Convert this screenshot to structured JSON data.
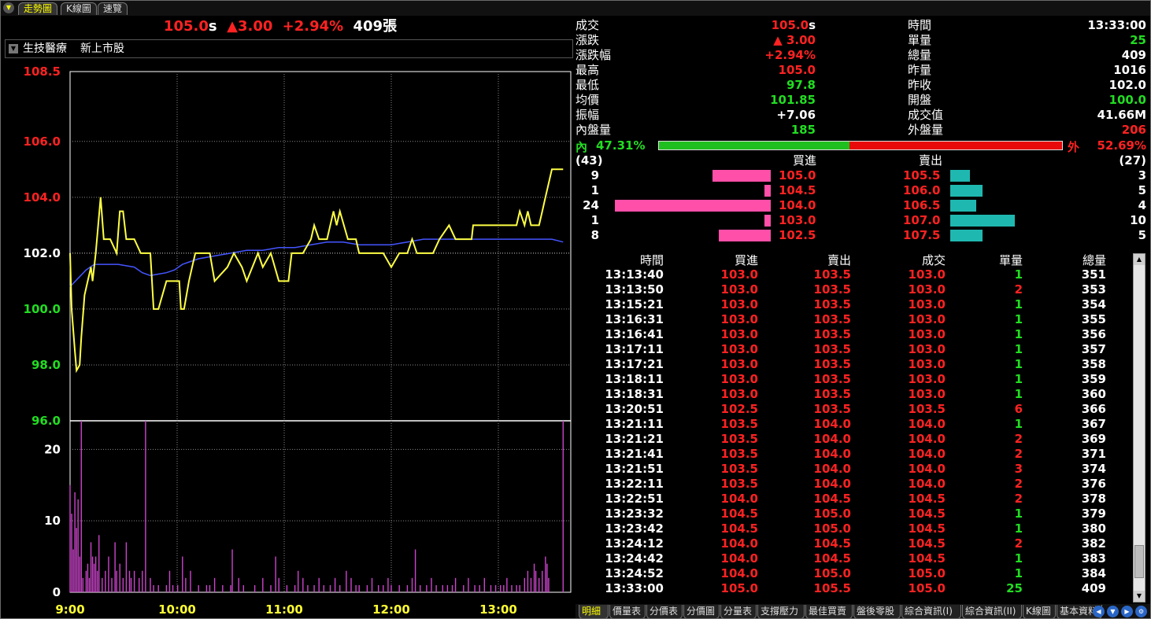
{
  "top_tabs": [
    "走勢圖",
    "K線圖",
    "速覽"
  ],
  "header": {
    "price": "105.0",
    "price_flag": "s",
    "change": "3.00",
    "change_pct": "+2.94%",
    "volume": "409",
    "volume_unit": "張"
  },
  "category": {
    "sector": "生技醫療",
    "market": "新上市股"
  },
  "info_left": [
    {
      "label": "成交",
      "value": "105.0",
      "suffix": "s",
      "color": "#ff2222"
    },
    {
      "label": "漲跌",
      "value": "▲ 3.00",
      "suffix": "",
      "color": "#ff2222"
    },
    {
      "label": "漲跌幅",
      "value": "+2.94%",
      "suffix": "",
      "color": "#ff2222"
    },
    {
      "label": "最高",
      "value": "105.0",
      "suffix": "",
      "color": "#ff2222"
    },
    {
      "label": "最低",
      "value": "97.8",
      "suffix": "",
      "color": "#22dd22"
    },
    {
      "label": "均價",
      "value": "101.85",
      "suffix": "",
      "color": "#22dd22"
    },
    {
      "label": "振幅",
      "value": "+7.06",
      "suffix": "",
      "color": "#ffffff"
    },
    {
      "label": "內盤量",
      "value": "185",
      "suffix": "",
      "color": "#22dd22"
    }
  ],
  "info_right": [
    {
      "label": "時間",
      "value": "13:33:00",
      "color": "#ffffff"
    },
    {
      "label": "單量",
      "value": "25",
      "color": "#22dd22"
    },
    {
      "label": "總量",
      "value": "409",
      "color": "#ffffff"
    },
    {
      "label": "昨量",
      "value": "1016",
      "color": "#ffffff"
    },
    {
      "label": "昨收",
      "value": "102.0",
      "color": "#ffffff"
    },
    {
      "label": "開盤",
      "value": "100.0",
      "color": "#22dd22"
    },
    {
      "label": "成交值",
      "value": "41.66M",
      "color": "#ffffff"
    },
    {
      "label": "外盤量",
      "value": "206",
      "color": "#ff2222"
    }
  ],
  "ratio": {
    "inner_label": "內",
    "inner_pct": "47.31%",
    "outer_label": "外",
    "outer_pct": "52.69%",
    "inner_fraction": 0.4731
  },
  "book": {
    "bid_total": "(43)",
    "ask_total": "(27)",
    "bid_header": "買進",
    "ask_header": "賣出",
    "levels": [
      {
        "bid_qty": 9,
        "bid": "105.0",
        "ask": "105.5",
        "ask_qty": 3
      },
      {
        "bid_qty": 1,
        "bid": "104.5",
        "ask": "106.0",
        "ask_qty": 5
      },
      {
        "bid_qty": 24,
        "bid": "104.0",
        "ask": "106.5",
        "ask_qty": 4
      },
      {
        "bid_qty": 1,
        "bid": "103.0",
        "ask": "107.0",
        "ask_qty": 10
      },
      {
        "bid_qty": 8,
        "bid": "102.5",
        "ask": "107.5",
        "ask_qty": 5
      }
    ]
  },
  "ticks": {
    "headers": [
      "時間",
      "買進",
      "賣出",
      "成交",
      "單量",
      "總量"
    ],
    "rows": [
      [
        "13:13:40",
        "103.0",
        "103.5",
        "103.0",
        "1",
        "351"
      ],
      [
        "13:13:50",
        "103.0",
        "103.5",
        "103.0",
        "2",
        "353"
      ],
      [
        "13:15:21",
        "103.0",
        "103.5",
        "103.0",
        "1",
        "354"
      ],
      [
        "13:16:31",
        "103.0",
        "103.5",
        "103.0",
        "1",
        "355"
      ],
      [
        "13:16:41",
        "103.0",
        "103.5",
        "103.0",
        "1",
        "356"
      ],
      [
        "13:17:11",
        "103.0",
        "103.5",
        "103.0",
        "1",
        "357"
      ],
      [
        "13:17:21",
        "103.0",
        "103.5",
        "103.0",
        "1",
        "358"
      ],
      [
        "13:18:11",
        "103.0",
        "103.5",
        "103.0",
        "1",
        "359"
      ],
      [
        "13:18:31",
        "103.0",
        "103.5",
        "103.0",
        "1",
        "360"
      ],
      [
        "13:20:51",
        "102.5",
        "103.5",
        "103.5",
        "6",
        "366"
      ],
      [
        "13:21:11",
        "103.5",
        "104.0",
        "104.0",
        "1",
        "367"
      ],
      [
        "13:21:21",
        "103.5",
        "104.0",
        "104.0",
        "2",
        "369"
      ],
      [
        "13:21:41",
        "103.5",
        "104.0",
        "104.0",
        "2",
        "371"
      ],
      [
        "13:21:51",
        "103.5",
        "104.0",
        "104.0",
        "3",
        "374"
      ],
      [
        "13:22:11",
        "103.5",
        "104.0",
        "104.0",
        "2",
        "376"
      ],
      [
        "13:22:51",
        "104.0",
        "104.5",
        "104.5",
        "2",
        "378"
      ],
      [
        "13:23:32",
        "104.5",
        "105.0",
        "104.5",
        "1",
        "379"
      ],
      [
        "13:23:42",
        "104.5",
        "105.0",
        "104.5",
        "1",
        "380"
      ],
      [
        "13:24:12",
        "104.0",
        "104.5",
        "104.5",
        "2",
        "382"
      ],
      [
        "13:24:42",
        "104.0",
        "104.5",
        "104.5",
        "1",
        "383"
      ],
      [
        "13:24:52",
        "104.0",
        "105.0",
        "105.0",
        "1",
        "384"
      ],
      [
        "13:33:00",
        "105.0",
        "105.5",
        "105.0",
        "25",
        "409"
      ]
    ],
    "last_row_qty_color": "#22dd22"
  },
  "bottom_tabs": [
    "明細",
    "價量表",
    "分價表",
    "分價圖",
    "分量表",
    "支撐壓力",
    "最佳買賣",
    "盤後零股",
    "綜合資訊(I)",
    "綜合資訊(II)",
    "K線圖",
    "基本資料"
  ],
  "chart_data": {
    "type": "line",
    "x_ticks": [
      "9:00",
      "10:00",
      "11:00",
      "12:00",
      "13:00"
    ],
    "price_ticks": [
      "108.5",
      "106.0",
      "104.0",
      "102.0",
      "100.0",
      "98.0",
      "96.0"
    ],
    "price_tick_values": [
      108.5,
      106.0,
      104.0,
      102.0,
      100.0,
      98.0,
      96.0
    ],
    "price_tick_colors": [
      "#ff2222",
      "#ff2222",
      "#ff2222",
      "#ffffff",
      "#22dd22",
      "#22dd22",
      "#22dd22"
    ],
    "ylim": [
      96.0,
      108.5
    ],
    "reference": 102.0,
    "volume_ticks": [
      "20",
      "10",
      "0"
    ],
    "volume_tick_values": [
      20,
      10,
      0
    ],
    "volume_ylim": [
      0,
      24
    ],
    "colors": {
      "price": "#ffff44",
      "average": "#4455ff",
      "volume": "#cc44cc"
    },
    "price_series": [
      [
        0,
        102.0
      ],
      [
        1,
        100.0
      ],
      [
        3,
        98.5
      ],
      [
        4,
        97.8
      ],
      [
        6,
        98.0
      ],
      [
        7,
        99.0
      ],
      [
        9,
        100.5
      ],
      [
        11,
        101.0
      ],
      [
        13,
        101.5
      ],
      [
        14,
        101.0
      ],
      [
        16,
        102.0
      ],
      [
        19,
        104.0
      ],
      [
        21,
        102.5
      ],
      [
        25,
        102.5
      ],
      [
        29,
        102.0
      ],
      [
        31,
        103.5
      ],
      [
        33,
        103.5
      ],
      [
        35,
        102.5
      ],
      [
        40,
        102.5
      ],
      [
        44,
        102.0
      ],
      [
        50,
        102.0
      ],
      [
        52,
        100.0
      ],
      [
        55,
        100.0
      ],
      [
        60,
        101.0
      ],
      [
        68,
        101.0
      ],
      [
        69,
        100.0
      ],
      [
        71,
        100.0
      ],
      [
        74,
        101.0
      ],
      [
        76,
        101.5
      ],
      [
        78,
        102.0
      ],
      [
        87,
        102.0
      ],
      [
        90,
        101.0
      ],
      [
        98,
        101.5
      ],
      [
        102,
        102.0
      ],
      [
        107,
        101.5
      ],
      [
        110,
        101.0
      ],
      [
        117,
        102.0
      ],
      [
        120,
        101.5
      ],
      [
        125,
        102.0
      ],
      [
        130,
        101.0
      ],
      [
        136,
        101.0
      ],
      [
        138,
        102.0
      ],
      [
        145,
        102.0
      ],
      [
        150,
        102.5
      ],
      [
        152,
        103.0
      ],
      [
        155,
        102.5
      ],
      [
        160,
        102.5
      ],
      [
        164,
        103.5
      ],
      [
        166,
        103.0
      ],
      [
        168,
        103.5
      ],
      [
        173,
        102.5
      ],
      [
        178,
        102.5
      ],
      [
        180,
        102.0
      ],
      [
        188,
        102.0
      ],
      [
        195,
        102.0
      ],
      [
        200,
        101.5
      ],
      [
        205,
        102.0
      ],
      [
        210,
        102.0
      ],
      [
        213,
        102.5
      ],
      [
        216,
        102.0
      ],
      [
        222,
        102.0
      ],
      [
        226,
        102.0
      ],
      [
        230,
        102.5
      ],
      [
        236,
        103.0
      ],
      [
        240,
        102.5
      ],
      [
        250,
        102.5
      ],
      [
        251,
        103.0
      ],
      [
        258,
        103.0
      ],
      [
        267,
        103.0
      ],
      [
        272,
        103.0
      ],
      [
        278,
        103.0
      ],
      [
        280,
        103.5
      ],
      [
        283,
        103.0
      ],
      [
        285,
        103.5
      ],
      [
        287,
        103.0
      ],
      [
        292,
        103.0
      ],
      [
        294,
        103.5
      ],
      [
        296,
        104.0
      ],
      [
        298,
        104.5
      ],
      [
        300,
        105.0
      ],
      [
        307,
        105.0
      ]
    ],
    "avg_series": [
      [
        0,
        100.8
      ],
      [
        5,
        101.1
      ],
      [
        10,
        101.4
      ],
      [
        15,
        101.6
      ],
      [
        20,
        101.6
      ],
      [
        30,
        101.6
      ],
      [
        40,
        101.5
      ],
      [
        45,
        101.3
      ],
      [
        50,
        101.2
      ],
      [
        60,
        101.3
      ],
      [
        65,
        101.4
      ],
      [
        70,
        101.6
      ],
      [
        75,
        101.7
      ],
      [
        80,
        101.8
      ],
      [
        90,
        101.9
      ],
      [
        100,
        102.0
      ],
      [
        110,
        102.1
      ],
      [
        120,
        102.1
      ],
      [
        130,
        102.2
      ],
      [
        140,
        102.2
      ],
      [
        150,
        102.3
      ],
      [
        160,
        102.4
      ],
      [
        170,
        102.4
      ],
      [
        180,
        102.3
      ],
      [
        190,
        102.3
      ],
      [
        200,
        102.3
      ],
      [
        210,
        102.4
      ],
      [
        220,
        102.5
      ],
      [
        230,
        102.5
      ],
      [
        240,
        102.5
      ],
      [
        250,
        102.5
      ],
      [
        260,
        102.5
      ],
      [
        270,
        102.5
      ],
      [
        280,
        102.5
      ],
      [
        290,
        102.5
      ],
      [
        300,
        102.5
      ],
      [
        307,
        102.4
      ]
    ],
    "volume_series": [
      [
        0,
        15
      ],
      [
        1,
        11
      ],
      [
        2,
        6
      ],
      [
        3,
        14
      ],
      [
        4,
        9
      ],
      [
        5,
        13
      ],
      [
        6,
        5
      ],
      [
        7,
        24
      ],
      [
        8,
        2
      ],
      [
        10,
        3
      ],
      [
        11,
        4
      ],
      [
        12,
        2
      ],
      [
        13,
        7
      ],
      [
        14,
        5
      ],
      [
        15,
        4
      ],
      [
        16,
        5
      ],
      [
        17,
        3
      ],
      [
        18,
        8
      ],
      [
        20,
        2
      ],
      [
        22,
        3
      ],
      [
        24,
        5
      ],
      [
        26,
        2
      ],
      [
        28,
        7
      ],
      [
        29,
        3
      ],
      [
        31,
        4
      ],
      [
        33,
        2
      ],
      [
        35,
        7
      ],
      [
        37,
        3
      ],
      [
        38,
        2
      ],
      [
        40,
        3
      ],
      [
        43,
        2
      ],
      [
        45,
        3
      ],
      [
        47,
        24
      ],
      [
        50,
        2
      ],
      [
        52,
        1
      ],
      [
        55,
        1
      ],
      [
        60,
        1
      ],
      [
        62,
        3
      ],
      [
        64,
        1
      ],
      [
        67,
        1
      ],
      [
        70,
        5
      ],
      [
        72,
        2
      ],
      [
        75,
        3
      ],
      [
        80,
        1
      ],
      [
        85,
        1
      ],
      [
        87,
        1
      ],
      [
        90,
        2
      ],
      [
        95,
        1
      ],
      [
        100,
        1
      ],
      [
        101,
        6
      ],
      [
        105,
        2
      ],
      [
        108,
        1
      ],
      [
        115,
        1
      ],
      [
        120,
        2
      ],
      [
        125,
        1
      ],
      [
        128,
        5
      ],
      [
        130,
        2
      ],
      [
        135,
        1
      ],
      [
        140,
        1
      ],
      [
        142,
        3
      ],
      [
        145,
        2
      ],
      [
        148,
        1
      ],
      [
        152,
        1
      ],
      [
        155,
        2
      ],
      [
        158,
        1
      ],
      [
        162,
        1
      ],
      [
        165,
        2
      ],
      [
        168,
        1
      ],
      [
        172,
        3
      ],
      [
        175,
        2
      ],
      [
        178,
        1
      ],
      [
        180,
        1
      ],
      [
        185,
        1
      ],
      [
        188,
        2
      ],
      [
        192,
        1
      ],
      [
        195,
        1
      ],
      [
        198,
        2
      ],
      [
        200,
        1
      ],
      [
        205,
        1
      ],
      [
        210,
        1
      ],
      [
        213,
        2
      ],
      [
        215,
        6
      ],
      [
        218,
        1
      ],
      [
        222,
        1
      ],
      [
        225,
        2
      ],
      [
        228,
        1
      ],
      [
        232,
        1
      ],
      [
        235,
        1
      ],
      [
        238,
        1
      ],
      [
        240,
        2
      ],
      [
        245,
        1
      ],
      [
        248,
        2
      ],
      [
        252,
        1
      ],
      [
        255,
        1
      ],
      [
        258,
        2
      ],
      [
        262,
        1
      ],
      [
        265,
        1
      ],
      [
        268,
        1
      ],
      [
        270,
        1
      ],
      [
        272,
        2
      ],
      [
        275,
        1
      ],
      [
        278,
        1
      ],
      [
        280,
        1
      ],
      [
        283,
        2
      ],
      [
        285,
        3
      ],
      [
        287,
        2
      ],
      [
        289,
        4
      ],
      [
        290,
        3
      ],
      [
        292,
        2
      ],
      [
        294,
        3
      ],
      [
        296,
        5
      ],
      [
        297,
        4
      ],
      [
        298,
        2
      ],
      [
        307,
        24
      ]
    ],
    "x_range_minutes": [
      0,
      280
    ]
  }
}
